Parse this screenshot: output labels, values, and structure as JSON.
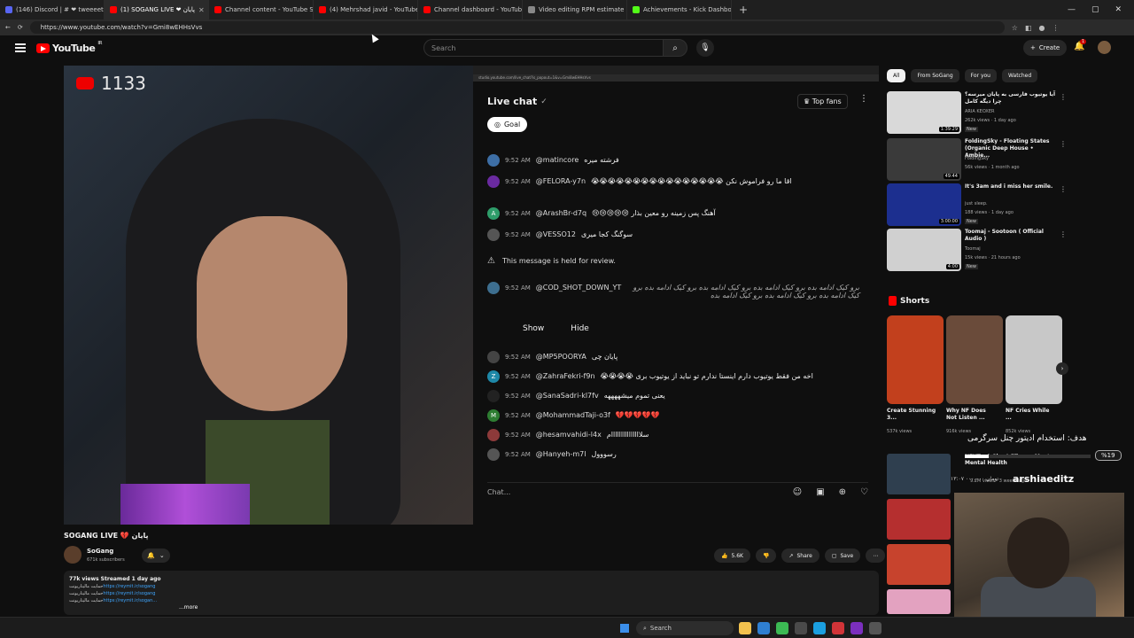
{
  "browser": {
    "tabs": [
      {
        "label": "(146) Discord | # ❤ tweeeets | M",
        "color": "#5865f2"
      },
      {
        "label": "(1) SOGANG LIVE ❤ پایان",
        "color": "#ff0000"
      },
      {
        "label": "Channel content - YouTube Studio",
        "color": "#ff0000"
      },
      {
        "label": "(4) Mehrshad javid - YouTube",
        "color": "#ff0000"
      },
      {
        "label": "Channel dashboard - YouTube St",
        "color": "#ff0000"
      },
      {
        "label": "Video editing RPM estimate",
        "color": "#888888"
      },
      {
        "label": "Achievements - Kick Dashboard",
        "color": "#53fc18"
      }
    ],
    "url": "https://www.youtube.com/watch?v=Gmi8wEHHsVvs"
  },
  "header": {
    "logo_text": "YouTube",
    "country": "IR",
    "search_placeholder": "Search",
    "create_label": "Create",
    "notif_count": "1"
  },
  "player": {
    "stream_counter": "1133",
    "chat_window_url": "studio.youtube.com/live_chat?is_popout=1&v=Gmi8wEHHsVvs",
    "chat": {
      "title": "Live chat",
      "top_fans": "Top fans",
      "goal": "Goal",
      "messages": [
        {
          "time": "9:52 AM",
          "name": "@matincore",
          "text": "فرشته میره",
          "av": "#3d6ea5",
          "init": ""
        },
        {
          "time": "9:52 AM",
          "name": "@FELORA-y7n",
          "text": "اقا ما رو فراموش نکن 😭😭😭😭😭😭😭😭😭😭😭😭😭😭😭😭",
          "av": "#6a2aa0",
          "init": ""
        },
        {
          "time": "9:52 AM",
          "name": "@ArashBr-d7q",
          "text": "آهنگ پس زمینه رو معین بذار 😢😢😢😢😢",
          "av": "#2e9d6a",
          "init": "A"
        },
        {
          "time": "9:52 AM",
          "name": "@VESSO12",
          "text": "سوگنگ کجا میری",
          "av": "#555555",
          "init": ""
        }
      ],
      "held_text": "This message is held for review.",
      "held_msg": {
        "time": "9:52 AM",
        "name": "@COD_SHOT_DOWN_YT",
        "text": "برو کیک ادامه بده برو کیک ادامه بده برو کیک ادامه بده برو کیک ادامه بده برو کیک ادامه بده برو کیک ادامه بده برو کیک ادامه بده"
      },
      "show_label": "Show",
      "hide_label": "Hide",
      "messages2": [
        {
          "time": "9:52 AM",
          "name": "@MP5POORYA",
          "text": "پایان چی",
          "av": "#444444",
          "init": ""
        },
        {
          "time": "9:52 AM",
          "name": "@ZahraFekri-f9n",
          "text": "اخه من فقط یوتیوب دارم اینستا ندارم تو نباید از یوتیوب بری 😭😭😭😭",
          "av": "#1e88a8",
          "init": "Z"
        },
        {
          "time": "9:52 AM",
          "name": "@SanaSadri-kl7fv",
          "text": "یعنی تموم میشههههه",
          "av": "#222222",
          "init": ""
        },
        {
          "time": "9:52 AM",
          "name": "@MohammadTaji-o3f",
          "text": "💔💔💔💔💔",
          "av": "#2e7d32",
          "init": "M"
        },
        {
          "time": "9:52 AM",
          "name": "@hesamvahidi-l4x",
          "text": "سلااااااااااااااام",
          "av": "#8d3a3a",
          "init": ""
        },
        {
          "time": "9:52 AM",
          "name": "@Hanyeh-m7l",
          "text": "رسووول",
          "av": "#555555",
          "init": ""
        }
      ],
      "input_placeholder": "Chat..."
    }
  },
  "video": {
    "title": "SOGANG LIVE 💔 پایان",
    "channel": "SoGang",
    "subs": "671k subscribers",
    "likes": "5.6K",
    "share": "Share",
    "save": "Save",
    "stats": "77k views  Streamed 1 day ago",
    "desc_lines": [
      {
        "prefix": "حمایت مالیناریونت",
        "link": "https://reymit.ir/sogang"
      },
      {
        "prefix": "حمایت مالیناریونت",
        "link": "https://reymit.ir/sogang"
      },
      {
        "prefix": "حمایت مالیناریونت",
        "link": "https://reymit.ir/sogan..."
      }
    ],
    "more": "...more"
  },
  "sidebar": {
    "chips": [
      "All",
      "From SoGang",
      "For you",
      "Watched"
    ],
    "recs": [
      {
        "title": "آیا یوتیوب فارسی به پایان میرسه؟ چرا دیگه کامل",
        "channel": "ARIA KEOXER",
        "views": "262k views · 1 day ago",
        "duration": "1:39:29",
        "new": "New",
        "color": "#d9d9d9"
      },
      {
        "title": "FoldingSky - Floating States (Organic Deep House • Ambie...",
        "channel": "FoldingSky",
        "views": "56k views · 1 month ago",
        "duration": "49:44",
        "new": "",
        "color": "#3a3a3a"
      },
      {
        "title": "It's 3am and i miss her smile.",
        "channel": "just sleep.",
        "views": "188 views · 1 day ago",
        "duration": "3:00:00",
        "new": "New",
        "color": "#1c2f8f"
      },
      {
        "title": "Toomaj - Sootoon ( Official Audio )",
        "channel": "Toomaj",
        "views": "15k views · 21 hours ago",
        "duration": "4:00",
        "new": "New",
        "color": "#d0d0d0"
      }
    ],
    "shorts_label": "Shorts",
    "shorts": [
      {
        "title": "Create Stunning 3...",
        "views": "537k views",
        "color": "#c2401d"
      },
      {
        "title": "Why NF Does Not Listen ...",
        "views": "916k views",
        "color": "#6a4b3a"
      },
      {
        "title": "NF Cries While ...",
        "views": "852k views",
        "color": "#c8c8c8"
      }
    ],
    "next_rec": {
      "title": "NEXT - A Short Film on Men's Mental Health",
      "views": "9.2M views · 3 weeks ago"
    }
  },
  "overlay": {
    "goal_text": "هدف: استخدام ادیتور چنل سرگرمی",
    "percent_text": "%19",
    "progress": 0.19,
    "editor_name": "arshiaeditz",
    "editor_sub": "۱۳:۰۷ تومان ۰۰۰,۰۰۰"
  },
  "taskbar": {
    "search_label": "Search"
  }
}
